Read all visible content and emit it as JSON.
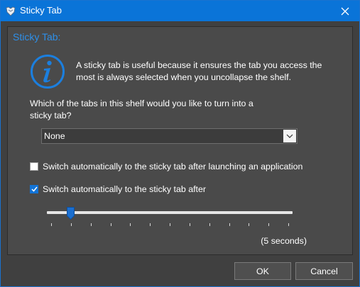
{
  "window": {
    "title": "Sticky Tab",
    "accent_color": "#0a74d8"
  },
  "panel": {
    "title": "Sticky Tab:",
    "title_color": "#2e8fe8",
    "description": "A sticky tab is useful because it ensures the tab you access the most is always selected when you uncollapse the shelf.",
    "question": "Which of the tabs in this shelf would you like to turn into a sticky tab?"
  },
  "tab_select": {
    "selected": "None"
  },
  "options": {
    "after_launch": {
      "label": "Switch automatically to the sticky tab after launching an application",
      "checked": false
    },
    "after_delay": {
      "label": "Switch automatically to the sticky tab after",
      "checked": true
    }
  },
  "delay_slider": {
    "value": 5,
    "min": 0,
    "max": 60,
    "tick_count": 13,
    "readout": "(5 seconds)"
  },
  "buttons": {
    "ok": "OK",
    "cancel": "Cancel"
  },
  "icons": {
    "app": "shelf-app-icon",
    "close": "close-icon",
    "info": "info-icon",
    "dropdown": "chevron-down-icon",
    "check": "checkmark-icon"
  }
}
